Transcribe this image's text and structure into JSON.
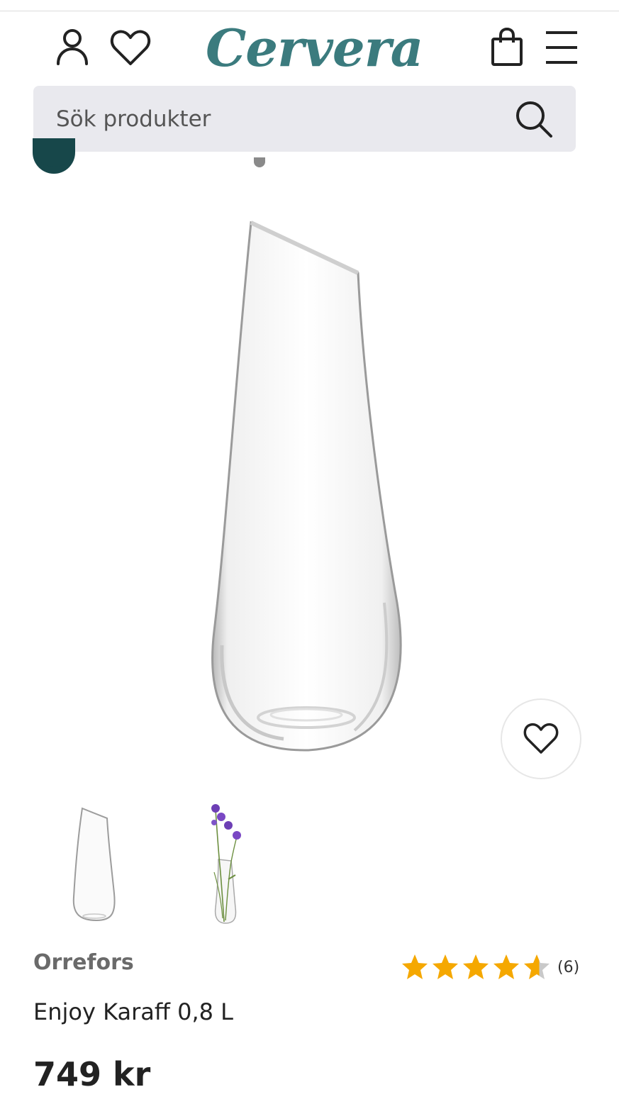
{
  "header": {
    "logo_text": "Cervera",
    "account_icon": "user-icon",
    "wishlist_icon": "heart-icon",
    "cart_icon": "shopping-bag-icon",
    "menu_icon": "hamburger-menu-icon"
  },
  "search": {
    "placeholder": "Sök produkter",
    "icon": "search-icon"
  },
  "colors": {
    "brand": "#3b7b7e",
    "search_bg": "#e9e9ee",
    "star": "#f5a800"
  },
  "product": {
    "brand": "Orrefors",
    "name": "Enjoy Karaff 0,8 L",
    "price": "749 kr",
    "rating": {
      "stars": 4.5,
      "max": 5,
      "count_label": "(6)"
    },
    "thumbnails": [
      {
        "name": "carafe-thumbnail"
      },
      {
        "name": "carafe-with-flowers-thumbnail"
      }
    ]
  }
}
